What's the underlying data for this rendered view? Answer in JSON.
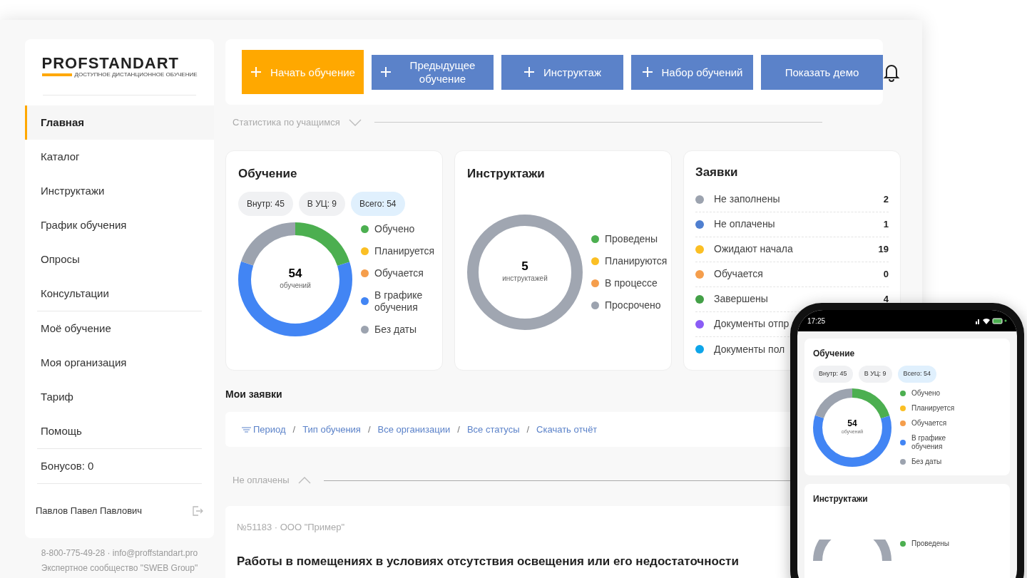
{
  "logo": {
    "name": "PROFSTANDART",
    "tagline": "ДОСТУПНОЕ ДИСТАНЦИОННОЕ ОБУЧЕНИЕ"
  },
  "sidebar": {
    "groups": [
      [
        {
          "label": "Главная",
          "selected": true
        },
        {
          "label": "Каталог",
          "selected": false
        },
        {
          "label": "Инструктажи",
          "selected": false
        },
        {
          "label": "График обучения",
          "selected": false
        },
        {
          "label": "Опросы",
          "selected": false
        },
        {
          "label": "Консультации",
          "selected": false
        }
      ],
      [
        {
          "label": "Моё обучение",
          "selected": false
        },
        {
          "label": "Моя организация",
          "selected": false
        },
        {
          "label": "Тариф",
          "selected": false
        },
        {
          "label": "Помощь",
          "selected": false
        }
      ],
      [
        {
          "label": "Бонусов: 0",
          "selected": false
        }
      ]
    ],
    "user": "Павлов Павел Павлович"
  },
  "footer": {
    "contacts": "8-800-775-49-28 · info@proffstandart.pro",
    "community": "Экспертное сообщество \"SWEB Group\""
  },
  "toolbar": {
    "buttons": [
      {
        "label": "Начать обучение",
        "kind": "primary"
      },
      {
        "label": "Предыдущее обучение",
        "kind": "secondary"
      },
      {
        "label": "Инструктаж",
        "kind": "secondary"
      },
      {
        "label": "Набор обучений",
        "kind": "secondary"
      },
      {
        "label": "Показать демо",
        "kind": "plain"
      }
    ]
  },
  "stats": {
    "heading": "Статистика по учащимся",
    "training": {
      "title": "Обучение",
      "chips": [
        {
          "label": "Внутр: 45",
          "selected": false
        },
        {
          "label": "В УЦ: 9",
          "selected": false
        },
        {
          "label": "Всего: 54",
          "selected": true
        }
      ],
      "total": "54",
      "unit": "обучений",
      "legend": [
        {
          "label": "Обучено",
          "color": "#4caf50"
        },
        {
          "label": "Планируется",
          "color": "#fbbf24"
        },
        {
          "label": "Обучается",
          "color": "#f59e4c"
        },
        {
          "label": "В графике обучения",
          "color": "#4285f4"
        },
        {
          "label": "Без даты",
          "color": "#9ca3af"
        }
      ]
    },
    "briefings": {
      "title": "Инструктажи",
      "total": "5",
      "unit": "инструктажей",
      "legend": [
        {
          "label": "Проведены",
          "color": "#4caf50"
        },
        {
          "label": "Планируются",
          "color": "#fbbf24"
        },
        {
          "label": "В процессе",
          "color": "#f59e4c"
        },
        {
          "label": "Просрочено",
          "color": "#9ca3af"
        }
      ]
    },
    "requests": {
      "title": "Заявки",
      "rows": [
        {
          "label": "Не заполнены",
          "count": "2",
          "color": "#9ca3af"
        },
        {
          "label": "Не оплачены",
          "count": "1",
          "color": "#4f7fd0"
        },
        {
          "label": "Ожидают начала",
          "count": "19",
          "color": "#fbbf24"
        },
        {
          "label": "Обучается",
          "count": "0",
          "color": "#f59e4c"
        },
        {
          "label": "Завершены",
          "count": "4",
          "color": "#43a047"
        },
        {
          "label": "Документы отпр",
          "color": "#8b5cf6"
        },
        {
          "label": "Документы пол",
          "color": "#0ea5e9"
        }
      ]
    }
  },
  "my_requests": {
    "title": "Мои заявки",
    "separator": "/",
    "filters": [
      "Период",
      "Тип обучения",
      "Все организации",
      "Все статусы",
      "Скачать отчёт"
    ],
    "section": "Не оплачены",
    "order": {
      "meta": "№51183 · ООО \"Пример\"",
      "title": "Работы в помещениях в условиях отсутствия освещения или его недостаточности"
    }
  },
  "phone": {
    "time": "17:25",
    "training": {
      "title": "Обучение",
      "chips": [
        {
          "label": "Внутр: 45",
          "selected": false
        },
        {
          "label": "В УЦ: 9",
          "selected": false
        },
        {
          "label": "Всего: 54",
          "selected": true
        }
      ],
      "total": "54",
      "unit": "обучений",
      "legend": [
        {
          "label": "Обучено",
          "color": "#4caf50"
        },
        {
          "label": "Планируется",
          "color": "#fbbf24"
        },
        {
          "label": "Обучается",
          "color": "#f59e4c"
        },
        {
          "label": "В графике обучения",
          "color": "#4285f4"
        },
        {
          "label": "Без даты",
          "color": "#9ca3af"
        }
      ]
    },
    "briefings": {
      "title": "Инструктажи",
      "legend": [
        {
          "label": "Проведены",
          "color": "#4caf50"
        }
      ]
    }
  }
}
